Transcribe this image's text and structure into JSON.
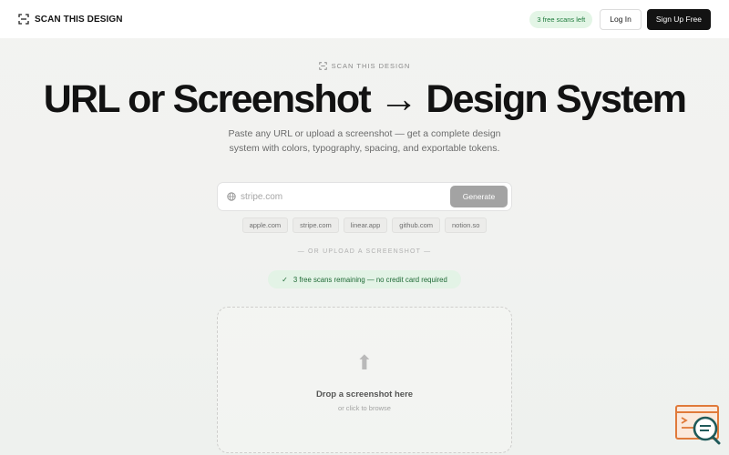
{
  "header": {
    "brand": "SCAN THIS DESIGN",
    "scans_badge": "3 free scans left",
    "login_label": "Log In",
    "signup_label": "Sign Up Free"
  },
  "hero": {
    "eyebrow": "SCAN THIS DESIGN",
    "title": "URL or Screenshot → Design System",
    "subtitle": "Paste any URL or upload a screenshot — get a complete design system with colors, typography, spacing, and exportable tokens."
  },
  "url_form": {
    "placeholder": "stripe.com",
    "generate_label": "Generate"
  },
  "suggestions": [
    "apple.com",
    "stripe.com",
    "linear.app",
    "github.com",
    "notion.so"
  ],
  "divider": "— OR UPLOAD A SCREENSHOT —",
  "free_note": {
    "check": "✓",
    "text": "3 free scans remaining — no credit card required"
  },
  "dropzone": {
    "icon": "⬆",
    "title": "Drop a screenshot here",
    "subtitle": "or click to browse"
  },
  "colors": {
    "accent_dark": "#131313",
    "success_bg": "#e3f5e6",
    "success_text": "#1e7a3c",
    "widget_orange": "#e07a3a",
    "widget_teal": "#1f5a5a"
  }
}
